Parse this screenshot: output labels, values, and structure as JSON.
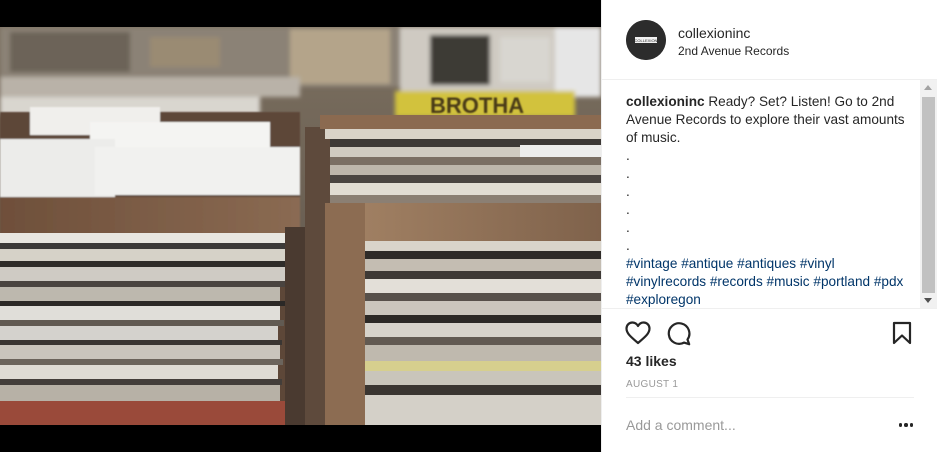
{
  "post": {
    "username": "collexioninc",
    "location": "2nd Avenue Records",
    "avatar_text": "COLLEXION",
    "caption": {
      "username": "collexioninc",
      "text": "Ready? Set? Listen! Go to 2nd Avenue Records to explore their vast amounts of music.",
      "dots": [
        ".",
        ".",
        ".",
        ".",
        ".",
        "."
      ],
      "hashtags": [
        "#vintage",
        "#antique",
        "#antiques",
        "#vinyl",
        "#vinylrecords",
        "#records",
        "#music",
        "#portland",
        "#pdx",
        "#exploregon"
      ]
    },
    "likes": "43 likes",
    "date": "AUGUST 1",
    "comment_placeholder": "Add a comment..."
  },
  "photo": {
    "sign_text": "BROTHA"
  },
  "icons": {
    "like": "heart-icon",
    "comment": "comment-icon",
    "save": "bookmark-icon",
    "more": "more-options-icon"
  },
  "colors": {
    "text": "#262626",
    "hashtag": "#003569",
    "muted": "#999999",
    "divider": "#efefef"
  }
}
